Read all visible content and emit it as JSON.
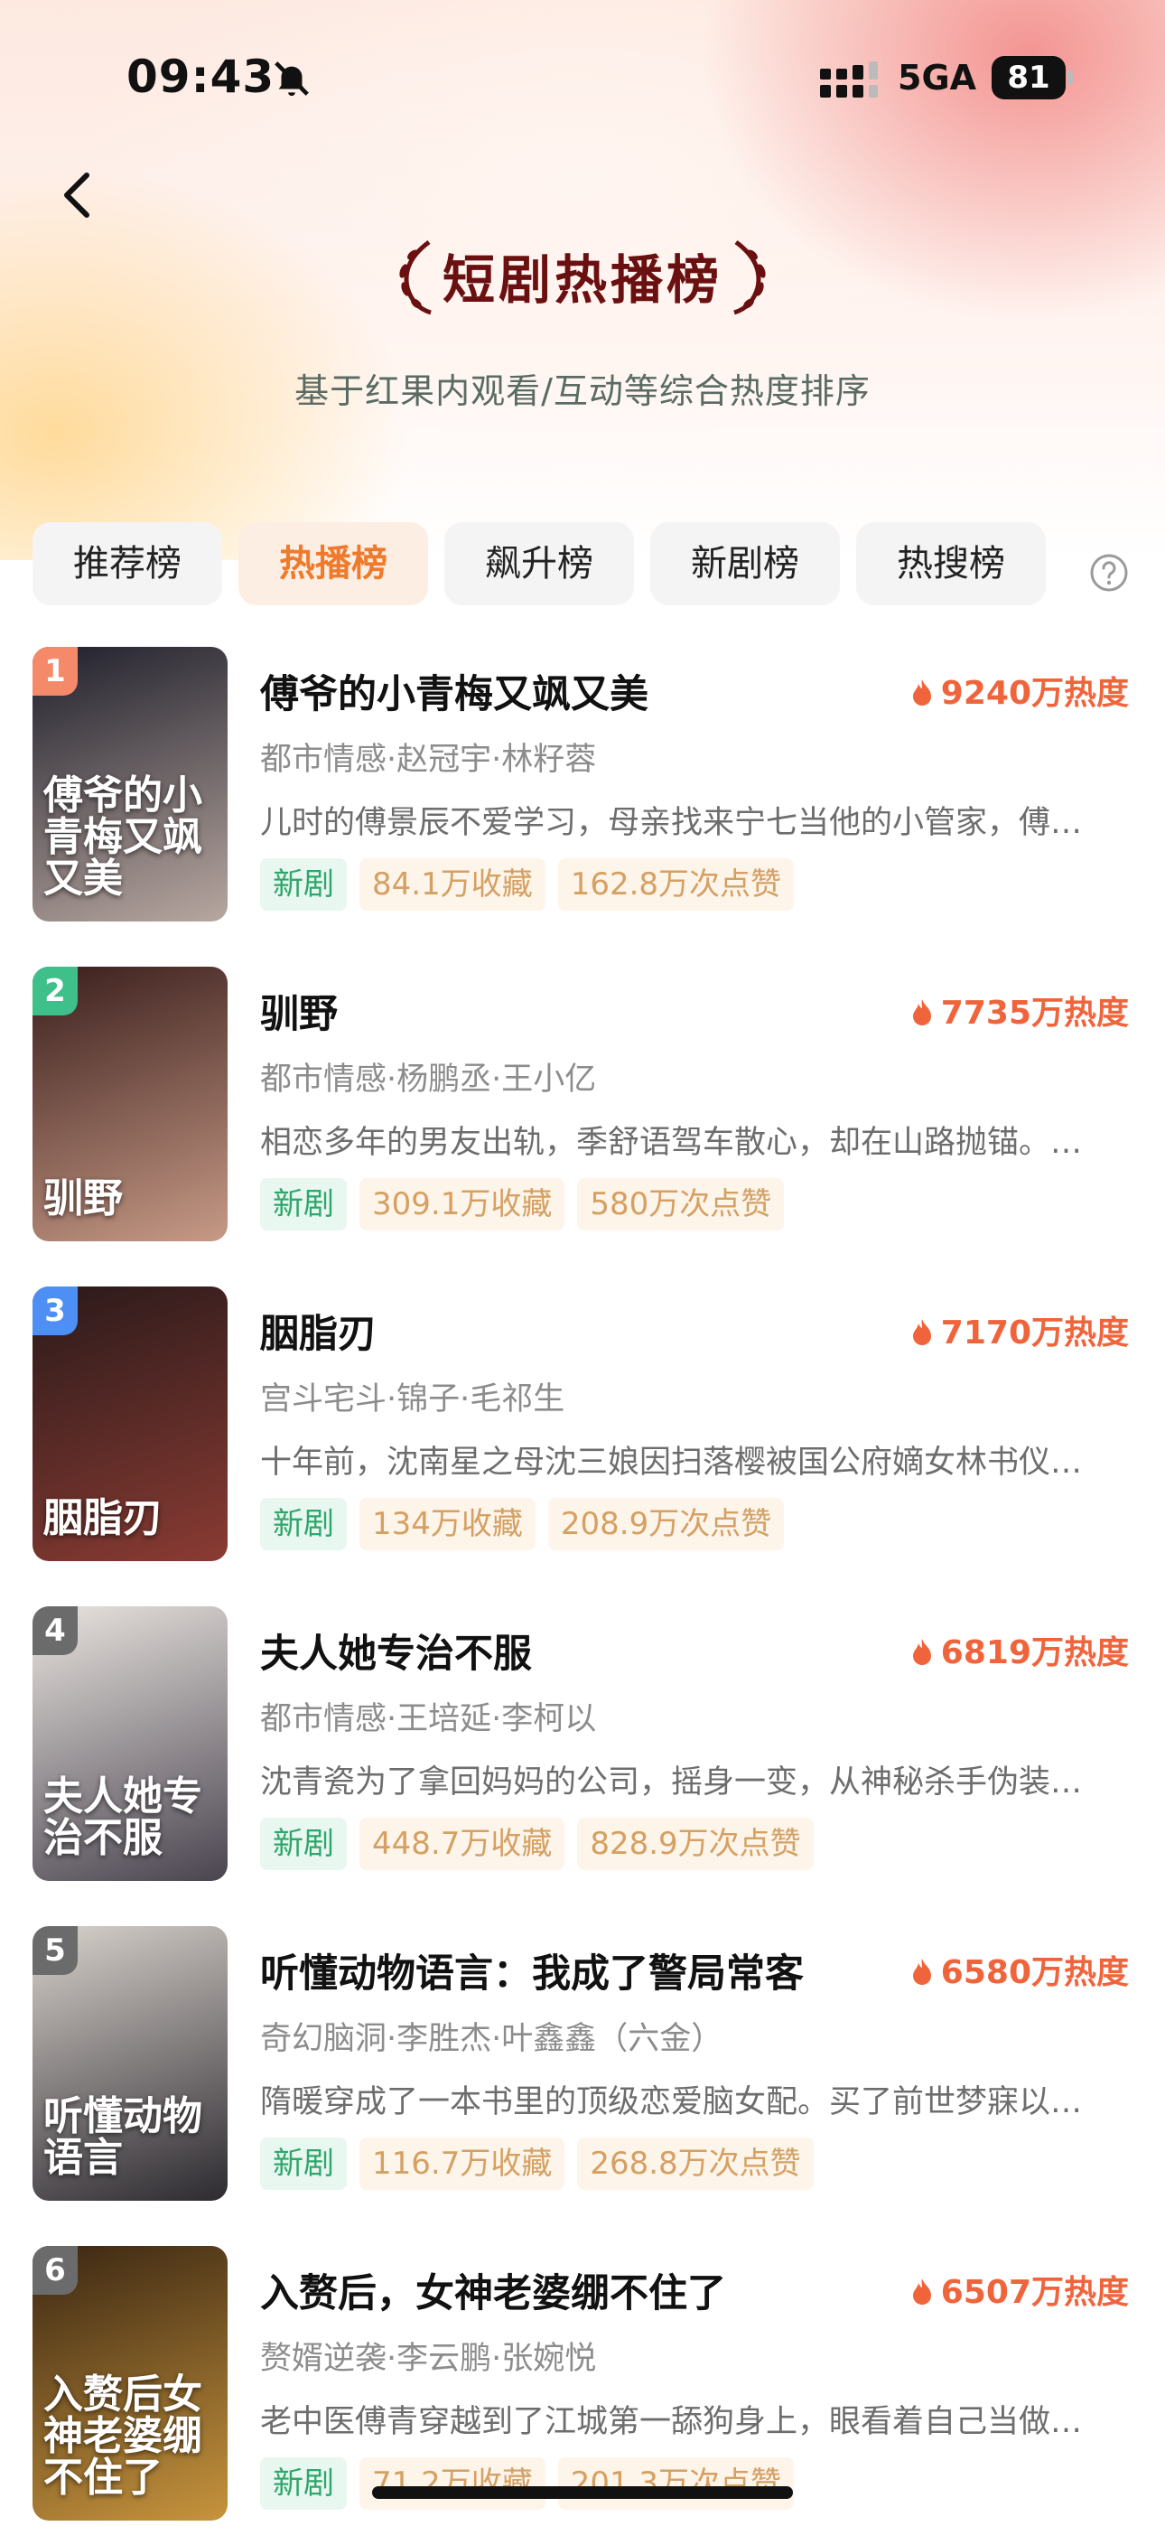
{
  "status_bar": {
    "time": "09:43",
    "network": "5GA",
    "battery": "81"
  },
  "header": {
    "title": "短剧热播榜",
    "subtitle": "基于红果内观看/互动等综合热度排序"
  },
  "tabs": [
    {
      "label": "推荐榜",
      "active": false
    },
    {
      "label": "热播榜",
      "active": true
    },
    {
      "label": "飙升榜",
      "active": false
    },
    {
      "label": "新剧榜",
      "active": false
    },
    {
      "label": "热搜榜",
      "active": false
    }
  ],
  "rank_colors": [
    "#f48a6a",
    "#3fbf8a",
    "#4d8ff5",
    "#6b6b6b",
    "#6b6b6b",
    "#6b6b6b"
  ],
  "items": [
    {
      "rank": "1",
      "title": "傅爷的小青梅又飒又美",
      "heat": "9240万热度",
      "genre": "都市情感·赵冠宇·林籽蓉",
      "desc": "儿时的傅景辰不爱学习，母亲找来宁七当他的小管家，傅…",
      "tags": [
        "新剧",
        "84.1万收藏",
        "162.8万次点赞"
      ],
      "poster_text": "傅爷的小青梅又飒又美",
      "poster_colors": [
        "#1f1f2b",
        "#b8a7a0"
      ]
    },
    {
      "rank": "2",
      "title": "驯野",
      "heat": "7735万热度",
      "genre": "都市情感·杨鹏丞·王小亿",
      "desc": "相恋多年的男友出轨，季舒语驾车散心，却在山路抛锚。…",
      "tags": [
        "新剧",
        "309.1万收藏",
        "580万次点赞"
      ],
      "poster_text": "驯野",
      "poster_colors": [
        "#3a1e1c",
        "#c79a86"
      ]
    },
    {
      "rank": "3",
      "title": "胭脂刃",
      "heat": "7170万热度",
      "genre": "宫斗宅斗·锦子·毛祁生",
      "desc": "十年前，沈南星之母沈三娘因扫落樱被国公府嫡女林书仪…",
      "tags": [
        "新剧",
        "134万收藏",
        "208.9万次点赞"
      ],
      "poster_text": "胭脂刃",
      "poster_colors": [
        "#2a1a1a",
        "#8a3b33"
      ]
    },
    {
      "rank": "4",
      "title": "夫人她专治不服",
      "heat": "6819万热度",
      "genre": "都市情感·王培延·李柯以",
      "desc": "沈青瓷为了拿回妈妈的公司，摇身一变，从神秘杀手伪装…",
      "tags": [
        "新剧",
        "448.7万收藏",
        "828.9万次点赞"
      ],
      "poster_text": "夫人她专治不服",
      "poster_colors": [
        "#e9e4df",
        "#4a4450"
      ]
    },
    {
      "rank": "5",
      "title": "听懂动物语言：我成了警局常客",
      "heat": "6580万热度",
      "genre": "奇幻脑洞·李胜杰·叶鑫鑫（六金）",
      "desc": "隋暖穿成了一本书里的顶级恋爱脑女配。买了前世梦寐以…",
      "tags": [
        "新剧",
        "116.7万收藏",
        "268.8万次点赞"
      ],
      "poster_text": "听懂动物语言",
      "poster_colors": [
        "#d8d2cc",
        "#2d2a30"
      ]
    },
    {
      "rank": "6",
      "title": "入赘后，女神老婆绷不住了",
      "heat": "6507万热度",
      "genre": "赘婿逆袭·李云鹏·张婉悦",
      "desc": "老中医傅青穿越到了江城第一舔狗身上，眼看着自己当做…",
      "tags": [
        "新剧",
        "71.2万收藏",
        "201.3万次点赞"
      ],
      "poster_text": "入赘后女神老婆绷不住了",
      "poster_colors": [
        "#3a2612",
        "#c7943d"
      ]
    }
  ]
}
